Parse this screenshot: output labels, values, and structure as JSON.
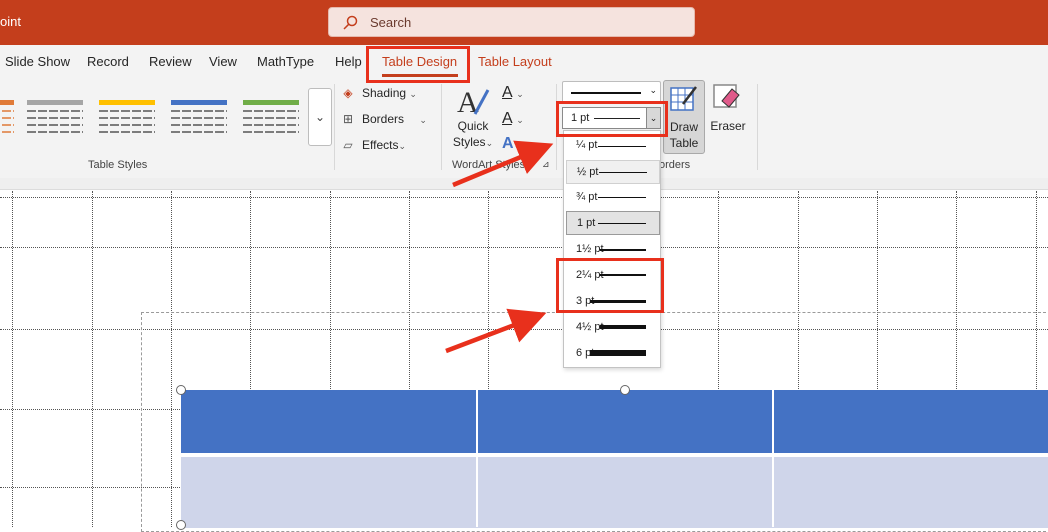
{
  "titlebar": {
    "app_name_fragment": "oint",
    "search_placeholder": "Search",
    "search_icon": "search-icon"
  },
  "tabs": [
    {
      "key": "slide_show",
      "label": "Slide Show"
    },
    {
      "key": "record",
      "label": "Record"
    },
    {
      "key": "review",
      "label": "Review"
    },
    {
      "key": "view",
      "label": "View"
    },
    {
      "key": "mathtype",
      "label": "MathType"
    },
    {
      "key": "help",
      "label": "Help"
    },
    {
      "key": "table_design",
      "label": "Table Design",
      "active": true
    },
    {
      "key": "table_layout",
      "label": "Table Layout"
    }
  ],
  "ribbon": {
    "table_styles": {
      "group_label": "Table Styles",
      "swatch_colors": [
        "#e07b39",
        "#a5a5a5",
        "#ffc000",
        "#4472c4",
        "#70ad47"
      ],
      "more_icon": "more-styles-icon"
    },
    "shading": {
      "label": "Shading",
      "icon": "paint-bucket-icon"
    },
    "borders": {
      "label": "Borders",
      "icon": "borders-icon"
    },
    "effects": {
      "label": "Effects",
      "icon": "effects-icon"
    },
    "wordart": {
      "group_label": "WordArt Styles",
      "quick_styles_line1": "Quick",
      "quick_styles_line2": "Styles",
      "text_fill_icon": "text-fill-icon",
      "text_outline_icon": "text-outline-icon",
      "text_effects_icon": "text-effects-icon",
      "launcher_icon": "dialog-launcher-icon"
    },
    "draw_borders": {
      "group_label_fragment": "orders",
      "pen_weight_value": "1 pt",
      "draw_table_line1": "Draw",
      "draw_table_line2": "Table",
      "eraser_label": "Eraser"
    }
  },
  "pen_weight_options": [
    "¼ pt",
    "½ pt",
    "¾ pt",
    "1 pt",
    "1½ pt",
    "2¼ pt",
    "3 pt",
    "4½ pt",
    "6 pt"
  ],
  "pen_weight_selected": "1 pt",
  "pen_weight_hovered": "½ pt",
  "colors": {
    "accent": "#c43e1c",
    "annotation": "#e8301c",
    "table_header": "#4472c4",
    "table_row": "#cfd5ea"
  }
}
